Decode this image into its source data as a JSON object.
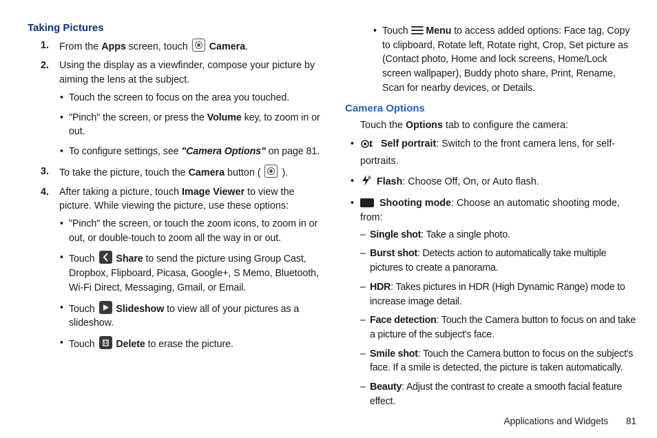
{
  "left": {
    "heading": "Taking Pictures",
    "steps": {
      "s1": {
        "num": "1.",
        "pre": "From the ",
        "apps": "Apps",
        "mid": " screen, touch ",
        "camera": "Camera",
        "post": "."
      },
      "s2": {
        "num": "2.",
        "text": "Using the display as a viewfinder, compose your picture by aiming the lens at the subject.",
        "b1": "Touch the screen to focus on the area you touched.",
        "b2_pre": "\"Pinch\" the screen, or press the ",
        "b2_vol": "Volume",
        "b2_post": " key, to zoom in or out.",
        "b3_pre": "To configure settings, see ",
        "b3_ref": "\"Camera Options\"",
        "b3_post": " on page 81."
      },
      "s3": {
        "num": "3.",
        "pre": "To take the picture, touch the ",
        "cam": "Camera",
        "mid": " button ( ",
        "post": " )."
      },
      "s4": {
        "num": "4.",
        "pre": "After taking a picture, touch ",
        "iv": "Image Viewer",
        "post": " to view the picture. While viewing the picture, use these options:",
        "b1": "\"Pinch\" the screen, or touch the zoom icons, to zoom in or out, or double-touch to zoom all the way in or out.",
        "b2_pre": "Touch ",
        "b2_share": "Share",
        "b2_post": " to send the picture using Group Cast, Dropbox, Flipboard, Picasa, Google+, S Memo, Bluetooth, Wi-Fi Direct, Messaging, Gmail, or Email.",
        "b3_pre": "Touch ",
        "b3_slide": "Slideshow",
        "b3_post": " to view all of your pictures as a slideshow.",
        "b4_pre": "Touch ",
        "b4_del": "Delete",
        "b4_post": " to erase the picture."
      }
    }
  },
  "right": {
    "topbullet_pre": "Touch ",
    "topbullet_menu": "Menu",
    "topbullet_post": " to access added options: Face tag, Copy to clipboard, Rotate left, Rotate right, Crop, Set picture as (Contact photo, Home and lock screens, Home/Lock screen wallpaper), Buddy photo share, Print, Rename, Scan for nearby devices, or Details.",
    "heading": "Camera Options",
    "intro_pre": "Touch the ",
    "intro_opt": "Options",
    "intro_post": " tab to configure the camera:",
    "opts": {
      "self_label": "Self portrait",
      "self_text": ": Switch to the front camera lens, for self-portraits.",
      "flash_label": "Flash",
      "flash_text": ": Choose Off, On, or Auto flash.",
      "shoot_label": "Shooting mode",
      "shoot_text": ": Choose an automatic shooting mode, from:",
      "modes": {
        "single_l": "Single shot",
        "single_t": ": Take a single photo.",
        "burst_l": "Burst shot",
        "burst_t": ": Detects action to automatically take multiple pictures to create a panorama.",
        "hdr_l": "HDR",
        "hdr_t": ": Takes pictures in HDR (High Dynamic Range) mode to increase image detail.",
        "face_l": "Face detection",
        "face_t": ": Touch the Camera button to focus on and take a picture of the subject's face.",
        "smile_l": "Smile shot",
        "smile_t": ": Touch the Camera button to focus on the subject's face. If a smile is detected, the picture is taken automatically.",
        "beauty_l": "Beauty",
        "beauty_t": ": Adjust the contrast to create a smooth facial feature effect."
      }
    }
  },
  "footer": {
    "section": "Applications and Widgets",
    "page": "81"
  }
}
